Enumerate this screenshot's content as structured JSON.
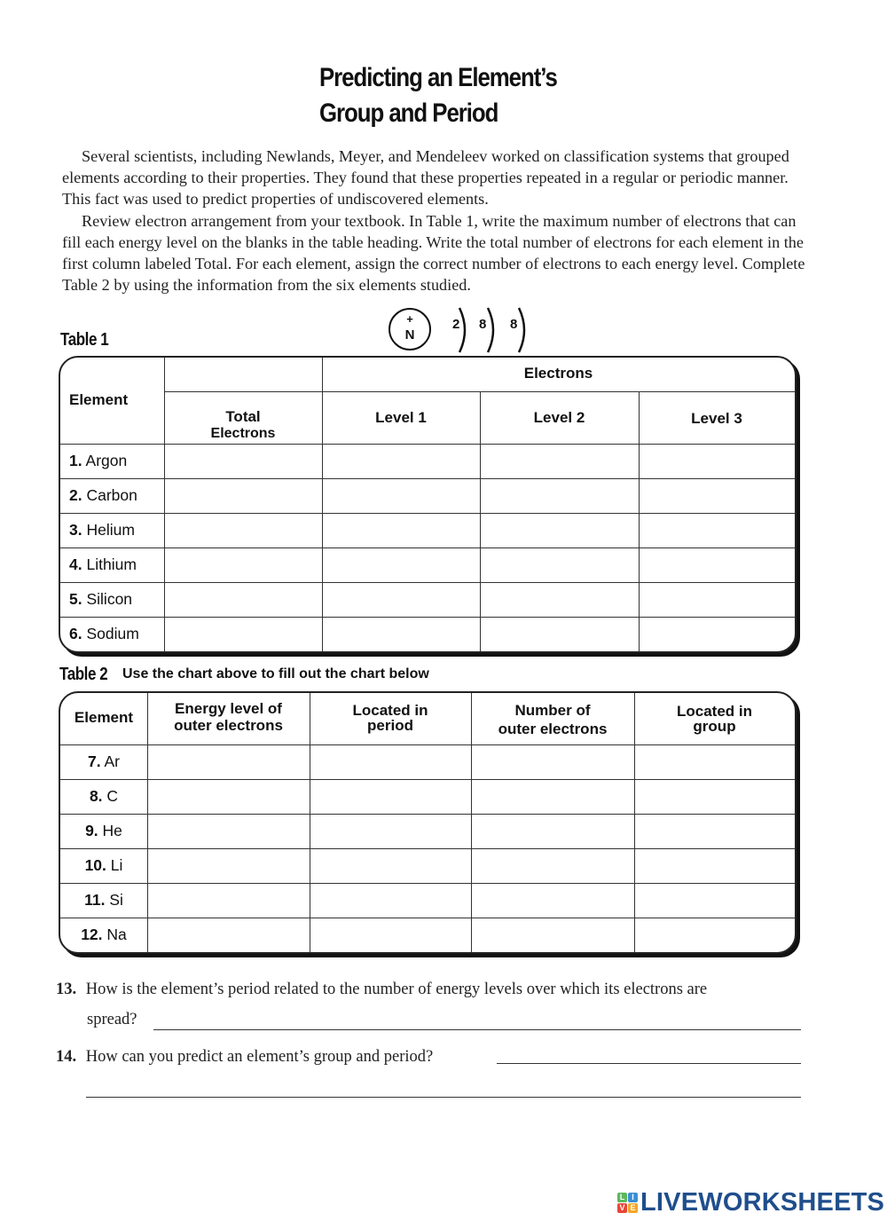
{
  "title": {
    "line1": "Predicting an Element’s",
    "line2": "Group and Period"
  },
  "intro": {
    "paragraph1": "Several scientists, including Newlands, Meyer, and Mendeleev worked on classification systems that grouped elements according to their properties. They found that these properties repeated in a regular or periodic manner. This fact was used to predict properties of undiscovered elements.",
    "paragraph2": "Review electron arrangement from your textbook. In Table 1, write the maximum number of electrons that can fill each energy level on the blanks in the table heading. Write the total number of electrons for each element in the first column labeled Total. For each element, assign the correct number of electrons to each energy level. Complete Table 2 by using the information from the six elements studied."
  },
  "atom_diagram": {
    "nucleus_charge": "+",
    "nucleus_label": "N",
    "shells": [
      "2",
      "8",
      "8"
    ]
  },
  "table1": {
    "label": "Table 1",
    "headers": {
      "element": "Element",
      "electrons_group": "Electrons",
      "total_line1": "Total",
      "total_line2": "Electrons",
      "level1": "Level 1",
      "level2": "Level 2",
      "level3": "Level 3"
    },
    "rows": [
      {
        "num": "1.",
        "name": "Argon",
        "total": "",
        "level1": "",
        "level2": "",
        "level3": ""
      },
      {
        "num": "2.",
        "name": "Carbon",
        "total": "",
        "level1": "",
        "level2": "",
        "level3": ""
      },
      {
        "num": "3.",
        "name": "Helium",
        "total": "",
        "level1": "",
        "level2": "",
        "level3": ""
      },
      {
        "num": "4.",
        "name": "Lithium",
        "total": "",
        "level1": "",
        "level2": "",
        "level3": ""
      },
      {
        "num": "5.",
        "name": "Silicon",
        "total": "",
        "level1": "",
        "level2": "",
        "level3": ""
      },
      {
        "num": "6.",
        "name": "Sodium",
        "total": "",
        "level1": "",
        "level2": "",
        "level3": ""
      }
    ]
  },
  "table2": {
    "label": "Table 2",
    "subtitle": "Use the chart above to fill out the chart below",
    "headers": {
      "element": "Element",
      "energy_level_l1": "Energy level of",
      "energy_level_l2": "outer electrons",
      "period_l1": "Located in",
      "period_l2": "period",
      "outer_l1": "Number of",
      "outer_l2": "outer electrons",
      "group_l1": "Located in",
      "group_l2": "group"
    },
    "rows": [
      {
        "num": "7.",
        "symbol": "Ar",
        "energy_level": "",
        "period": "",
        "outer": "",
        "group": ""
      },
      {
        "num": "8.",
        "symbol": "C",
        "energy_level": "",
        "period": "",
        "outer": "",
        "group": ""
      },
      {
        "num": "9.",
        "symbol": "He",
        "energy_level": "",
        "period": "",
        "outer": "",
        "group": ""
      },
      {
        "num": "10.",
        "symbol": "Li",
        "energy_level": "",
        "period": "",
        "outer": "",
        "group": ""
      },
      {
        "num": "11.",
        "symbol": "Si",
        "energy_level": "",
        "period": "",
        "outer": "",
        "group": ""
      },
      {
        "num": "12.",
        "symbol": "Na",
        "energy_level": "",
        "period": "",
        "outer": "",
        "group": ""
      }
    ]
  },
  "questions": [
    {
      "num": "13.",
      "text_line1": "How is the element’s period related to the number of energy levels over which its electrons are",
      "text_line2": "spread?",
      "answer": ""
    },
    {
      "num": "14.",
      "text_line1": "How can you predict an element’s group and period?",
      "answer": ""
    }
  ],
  "footer": {
    "logo_letters": [
      "L",
      "I",
      "V",
      "E"
    ],
    "logo_colors": [
      "#5cb85c",
      "#3a8fd6",
      "#e8463a",
      "#f5a623"
    ],
    "brand": "LIVEWORKSHEETS",
    "brand_color": "#1f4e8c"
  }
}
